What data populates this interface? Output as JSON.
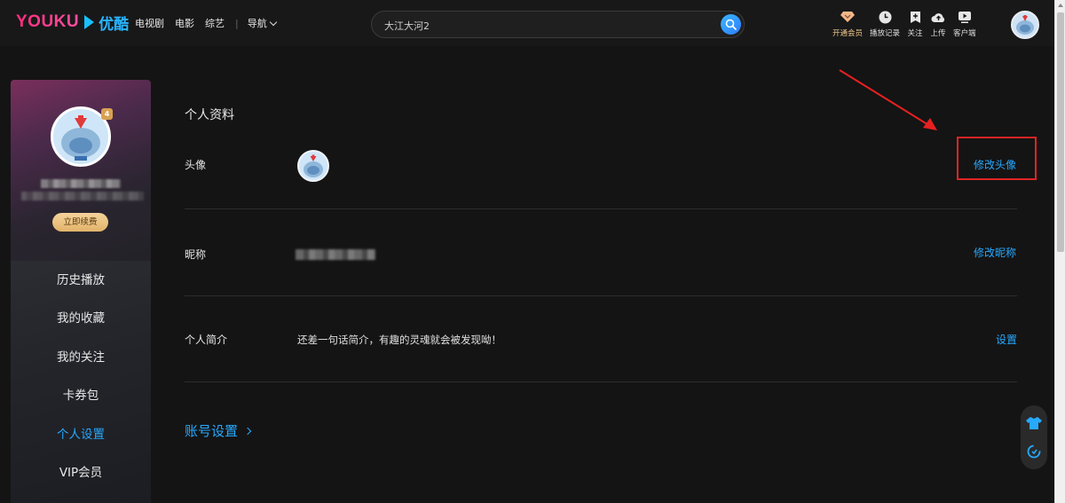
{
  "header": {
    "logo_en": "YOUKU",
    "logo_cn": "优酷",
    "nav": [
      "电视剧",
      "电影",
      "综艺"
    ],
    "nav_guide": "导航",
    "search_value": "大江大河2",
    "tools": [
      {
        "label": "开通会员",
        "icon": "diamond-icon"
      },
      {
        "label": "播放记录",
        "icon": "clock-icon"
      },
      {
        "label": "关注",
        "icon": "bookmark-plus-icon"
      },
      {
        "label": "上传",
        "icon": "cloud-upload-icon"
      },
      {
        "label": "客户端",
        "icon": "tv-play-icon"
      }
    ],
    "colors": {
      "brand_pink": "#ff2e7e",
      "brand_blue": "#2ab4ff",
      "accent": "#27a9ff"
    }
  },
  "sidebar": {
    "level": "4",
    "renew_label": "立即续费",
    "menu": [
      {
        "label": "历史播放",
        "active": false
      },
      {
        "label": "我的收藏",
        "active": false
      },
      {
        "label": "我的关注",
        "active": false
      },
      {
        "label": "卡券包",
        "active": false
      },
      {
        "label": "个人设置",
        "active": true
      },
      {
        "label": "VIP会员",
        "active": false
      }
    ]
  },
  "main": {
    "section_title": "个人资料",
    "avatar_label": "头像",
    "avatar_action": "修改头像",
    "nickname_label": "昵称",
    "nickname_action": "修改昵称",
    "bio_label": "个人简介",
    "bio_text": "还差一句话简介，有趣的灵魂就会被发现呦！",
    "bio_action": "设置",
    "account_settings": "账号设置"
  }
}
